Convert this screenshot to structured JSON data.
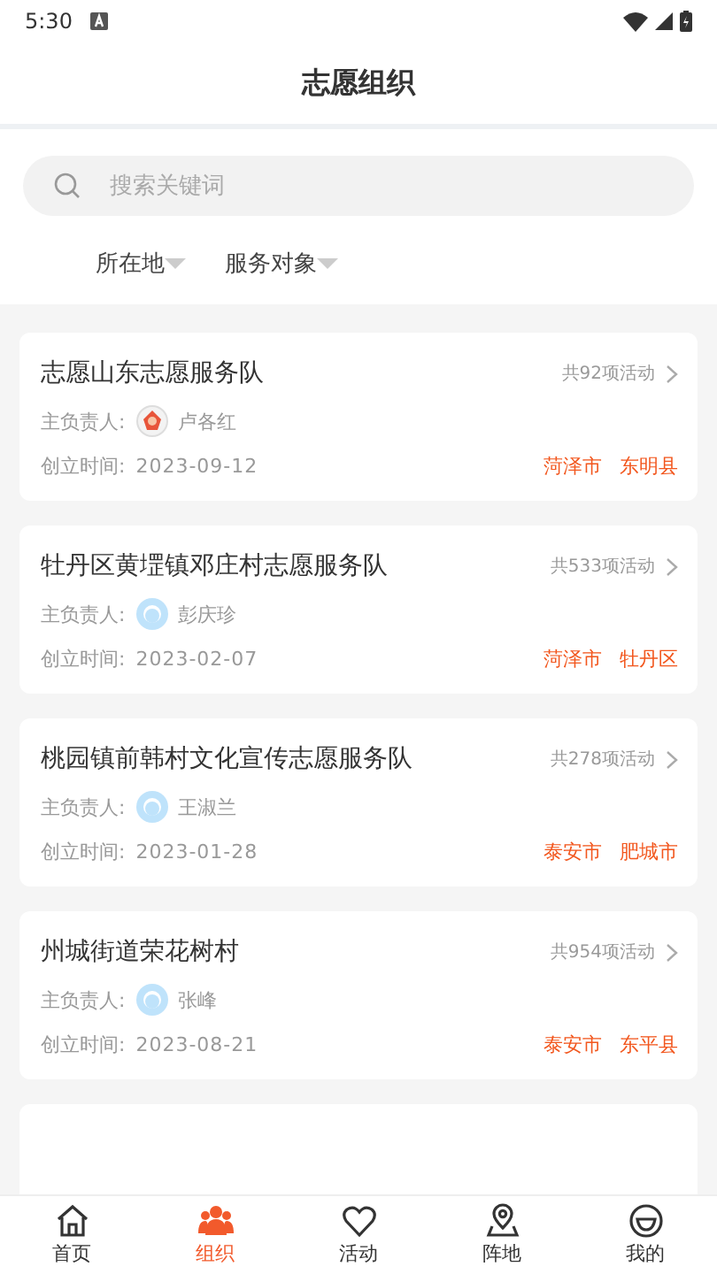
{
  "status_bar": {
    "time": "5:30"
  },
  "header": {
    "title": "志愿组织"
  },
  "search": {
    "placeholder": "搜索关键词"
  },
  "filters": [
    {
      "label": "所在地"
    },
    {
      "label": "服务对象"
    }
  ],
  "organizations": [
    {
      "name": "志愿山东志愿服务队",
      "activity_count": "共92项活动",
      "leader_label": "主负责人:",
      "leader": "卢各红",
      "avatar": {
        "kind": "image"
      },
      "founded_label": "创立时间:",
      "founded": "2023-09-12",
      "city": "菏泽市",
      "district": "东明县"
    },
    {
      "name": "牡丹区黄堽镇邓庄村志愿服务队",
      "activity_count": "共533项活动",
      "leader_label": "主负责人:",
      "leader": "彭庆珍",
      "avatar": {
        "kind": "default"
      },
      "founded_label": "创立时间:",
      "founded": "2023-02-07",
      "city": "菏泽市",
      "district": "牡丹区"
    },
    {
      "name": "桃园镇前韩村文化宣传志愿服务队",
      "activity_count": "共278项活动",
      "leader_label": "主负责人:",
      "leader": "王淑兰",
      "avatar": {
        "kind": "default"
      },
      "founded_label": "创立时间:",
      "founded": "2023-01-28",
      "city": "泰安市",
      "district": "肥城市"
    },
    {
      "name": "州城街道荣花树村",
      "activity_count": "共954项活动",
      "leader_label": "主负责人:",
      "leader": "张峰",
      "avatar": {
        "kind": "default"
      },
      "founded_label": "创立时间:",
      "founded": "2023-08-21",
      "city": "泰安市",
      "district": "东平县"
    }
  ],
  "tabs": [
    {
      "label": "首页",
      "selected": false
    },
    {
      "label": "组织",
      "selected": true
    },
    {
      "label": "活动",
      "selected": false
    },
    {
      "label": "阵地",
      "selected": false
    },
    {
      "label": "我的",
      "selected": false
    }
  ]
}
